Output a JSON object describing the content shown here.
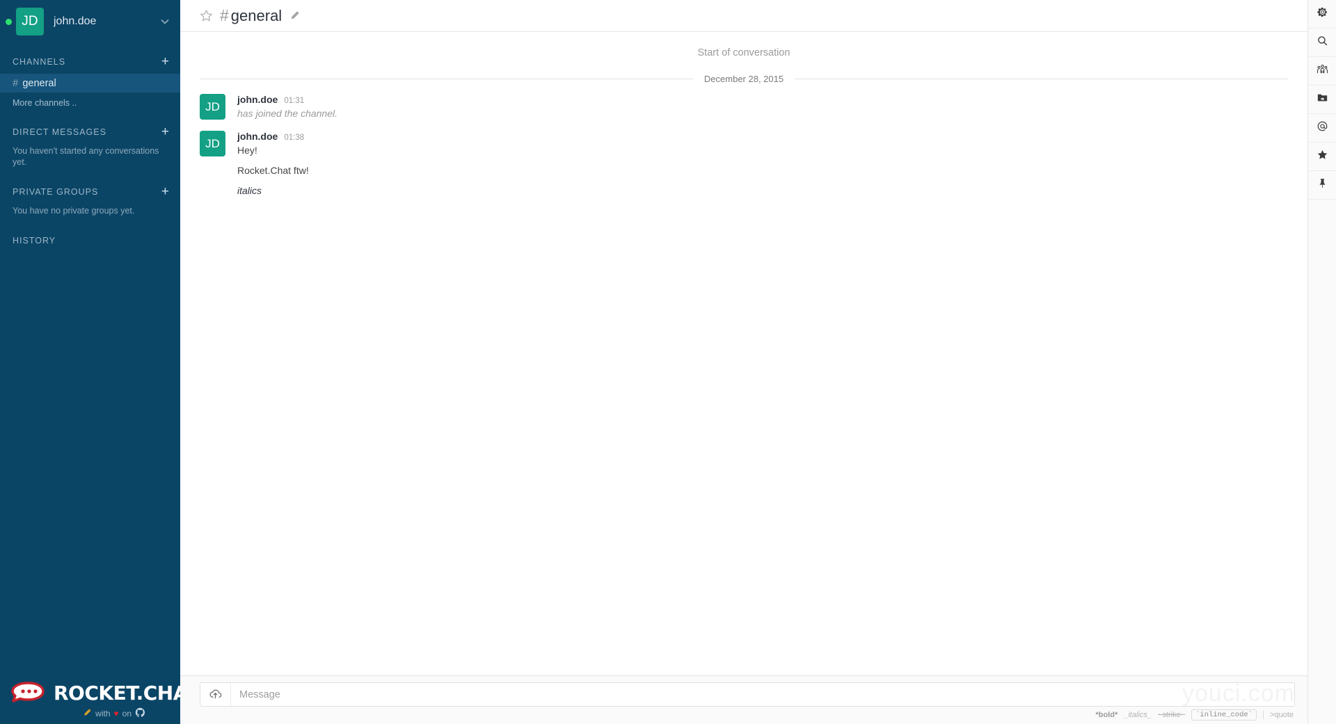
{
  "sidebar": {
    "account": {
      "initials": "JD",
      "username": "john.doe",
      "status": "online",
      "status_color": "#2de06e",
      "avatar_color": "#13a085",
      "chevron_icon": "chevron-down-icon"
    },
    "sections": [
      {
        "title": "CHANNELS",
        "add_label": "+",
        "rooms": [
          {
            "hash": "#",
            "name": "general",
            "active": true
          }
        ],
        "link": "More channels ..",
        "note": ""
      },
      {
        "title": "DIRECT MESSAGES",
        "add_label": "+",
        "rooms": [],
        "link": "",
        "note": "You haven't started any conversations yet."
      },
      {
        "title": "PRIVATE GROUPS",
        "add_label": "+",
        "rooms": [],
        "link": "",
        "note": "You have no private groups yet."
      },
      {
        "title": "HISTORY",
        "add_label": "",
        "rooms": [],
        "link": "",
        "note": ""
      }
    ],
    "footer": {
      "brand": "ROCKET.CHAT",
      "tag_with": "with",
      "tag_on": "on",
      "heart": "♥",
      "pencil_icon": "pencil-icon",
      "github_icon": "github-icon",
      "background": "#0b4566"
    }
  },
  "header": {
    "star_icon": "star-outline-icon",
    "hash": "#",
    "title": "general",
    "edit_icon": "pencil-icon"
  },
  "conversation": {
    "start_label": "Start of conversation",
    "date_divider": "December 28, 2015",
    "messages": [
      {
        "initials": "JD",
        "username": "john.doe",
        "time": "01:31",
        "lines": [
          {
            "text": "has joined the channel.",
            "style": "system"
          }
        ]
      },
      {
        "initials": "JD",
        "username": "john.doe",
        "time": "01:38",
        "lines": [
          {
            "text": "Hey!",
            "style": "plain"
          },
          {
            "text": "Rocket.Chat ftw!",
            "style": "plain"
          },
          {
            "text": "italics",
            "style": "ital"
          }
        ]
      }
    ]
  },
  "composer": {
    "upload_icon": "cloud-upload-icon",
    "placeholder": "Message",
    "value": "",
    "hints": {
      "bold": "*bold*",
      "italics": "_italics_",
      "strike": "~strike~",
      "code": "`inline_code`",
      "quote": ">quote"
    }
  },
  "watermark": "youci.com",
  "right_toolbar": {
    "buttons": [
      {
        "icon": "gear-icon",
        "name": "admin-settings"
      },
      {
        "icon": "search-icon",
        "name": "search-messages"
      },
      {
        "icon": "users-icon",
        "name": "members-list"
      },
      {
        "icon": "folder-share-icon",
        "name": "uploaded-files"
      },
      {
        "icon": "at-sign-icon",
        "name": "mentions"
      },
      {
        "icon": "star-icon",
        "name": "starred-messages"
      },
      {
        "icon": "pin-icon",
        "name": "pinned-messages"
      }
    ]
  }
}
